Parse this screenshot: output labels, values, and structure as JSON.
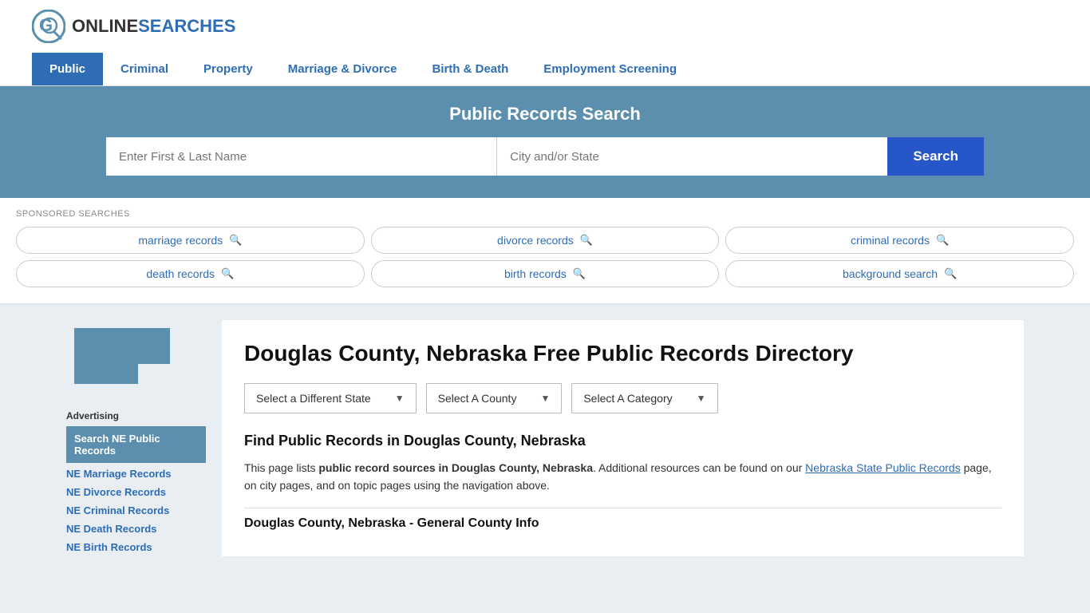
{
  "site": {
    "logo_online": "ONLINE",
    "logo_searches": "SEARCHES"
  },
  "nav": {
    "items": [
      {
        "label": "Public",
        "active": true
      },
      {
        "label": "Criminal",
        "active": false
      },
      {
        "label": "Property",
        "active": false
      },
      {
        "label": "Marriage & Divorce",
        "active": false
      },
      {
        "label": "Birth & Death",
        "active": false
      },
      {
        "label": "Employment Screening",
        "active": false
      }
    ]
  },
  "hero": {
    "title": "Public Records Search",
    "name_placeholder": "Enter First & Last Name",
    "location_placeholder": "City and/or State",
    "search_button": "Search"
  },
  "sponsored": {
    "label": "SPONSORED SEARCHES",
    "tags": [
      "marriage records",
      "divorce records",
      "criminal records",
      "death records",
      "birth records",
      "background search"
    ]
  },
  "sidebar": {
    "advertising_label": "Advertising",
    "ad_highlight": "Search NE Public Records",
    "ad_links": [
      "NE Marriage Records",
      "NE Divorce Records",
      "NE Criminal Records",
      "NE Death Records",
      "NE Birth Records"
    ]
  },
  "main": {
    "page_title": "Douglas County, Nebraska Free Public Records Directory",
    "dropdown_state": "Select a Different State",
    "dropdown_county": "Select A County",
    "dropdown_category": "Select A Category",
    "find_heading": "Find Public Records in Douglas County, Nebraska",
    "description_part1": "This page lists ",
    "description_bold": "public record sources in Douglas County, Nebraska",
    "description_part2": ". Additional resources can be found on our ",
    "description_link": "Nebraska State Public Records",
    "description_part3": " page, on city pages, and on topic pages using the navigation above.",
    "general_info_heading": "Douglas County, Nebraska - General County Info"
  }
}
